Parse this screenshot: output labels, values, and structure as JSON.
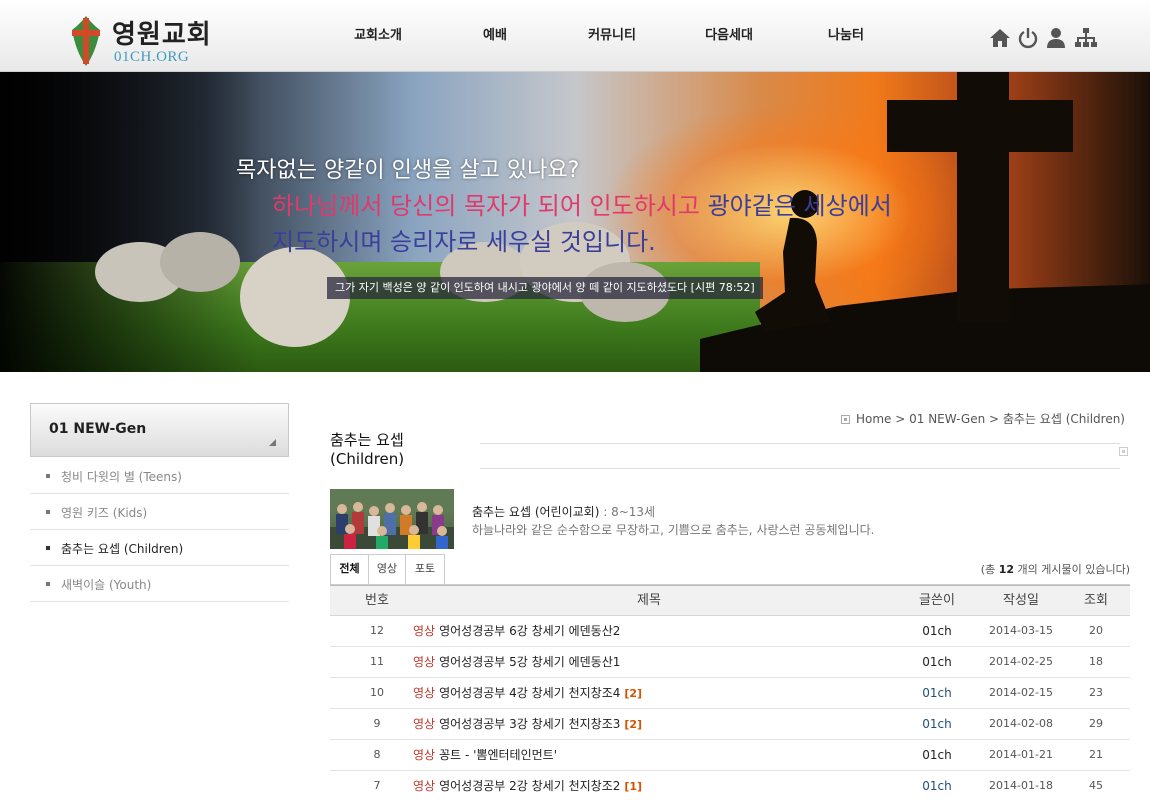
{
  "header": {
    "logo_title": "영원교회",
    "logo_sub": "01CH.ORG",
    "nav": [
      "교회소개",
      "예배",
      "커뮤니티",
      "다음세대",
      "나눔터"
    ],
    "util_icons": [
      "home-icon",
      "power-icon",
      "user-icon",
      "sitemap-icon"
    ]
  },
  "banner": {
    "line1": "목자없는 양같이 인생을 살고 있나요?",
    "line2_a": "하나님께서 당신의 목자가 되어 인도하시고 ",
    "line2_b": "광야같은 세상에서",
    "line3": "지도하시며 승리자로 세우실 것입니다.",
    "verse": "그가 자기 백성은 양 같이 인도하여 내시고 광야에서 양 떼 같이 지도하셨도다 [시편 78:52]",
    "colors": {
      "highlight_pink": "#e03a6c",
      "highlight_blue": "#3b3f9a"
    }
  },
  "sidebar": {
    "title": "01 NEW-Gen",
    "items": [
      {
        "label": "청비 다윗의 별 (Teens)",
        "active": false
      },
      {
        "label": "영원 키즈 (Kids)",
        "active": false
      },
      {
        "label": "춤추는 요셉 (Children)",
        "active": true
      },
      {
        "label": "새벽이슬 (Youth)",
        "active": false
      }
    ]
  },
  "breadcrumb": "Home > 01 NEW-Gen > 춤추는 요셉 (Children)",
  "page_title_1": "춤추는 요셉",
  "page_title_2": "(Children)",
  "intro": {
    "heading": "춤추는 요셉 (어린이교회)",
    "age": " : 8~13세",
    "desc": "하늘나라와 같은 순수함으로 무장하고, 기쁨으로 춤추는, 사랑스런 공동체입니다."
  },
  "tabs": [
    "전체",
    "영상",
    "포토"
  ],
  "total": {
    "prefix": "(총 ",
    "count": "12",
    "suffix": " 개의 게시물이 있습니다)"
  },
  "table": {
    "headers": [
      "번호",
      "제목",
      "글쓴이",
      "작성일",
      "조회"
    ],
    "rows": [
      {
        "no": "12",
        "cat": "영상",
        "title": "영어성경공부 6강 창세기 에덴동산2",
        "comments": "",
        "writer": "01ch",
        "date": "2014-03-15",
        "hits": "20",
        "writer_linked": false
      },
      {
        "no": "11",
        "cat": "영상",
        "title": "영어성경공부 5강 창세기 에덴동산1",
        "comments": "",
        "writer": "01ch",
        "date": "2014-02-25",
        "hits": "18",
        "writer_linked": false
      },
      {
        "no": "10",
        "cat": "영상",
        "title": "영어성경공부 4강 창세기 천지창조4",
        "comments": "[2]",
        "writer": "01ch",
        "date": "2014-02-15",
        "hits": "23",
        "writer_linked": true
      },
      {
        "no": "9",
        "cat": "영상",
        "title": "영어성경공부 3강 창세기 천지창조3",
        "comments": "[2]",
        "writer": "01ch",
        "date": "2014-02-08",
        "hits": "29",
        "writer_linked": true
      },
      {
        "no": "8",
        "cat": "영상",
        "title": "꽁트 - '뽐엔터테인먼트'",
        "comments": "",
        "writer": "01ch",
        "date": "2014-01-21",
        "hits": "21",
        "writer_linked": false
      },
      {
        "no": "7",
        "cat": "영상",
        "title": "영어성경공부 2강 창세기 천지창조2",
        "comments": "[1]",
        "writer": "01ch",
        "date": "2014-01-18",
        "hits": "45",
        "writer_linked": true
      }
    ]
  }
}
